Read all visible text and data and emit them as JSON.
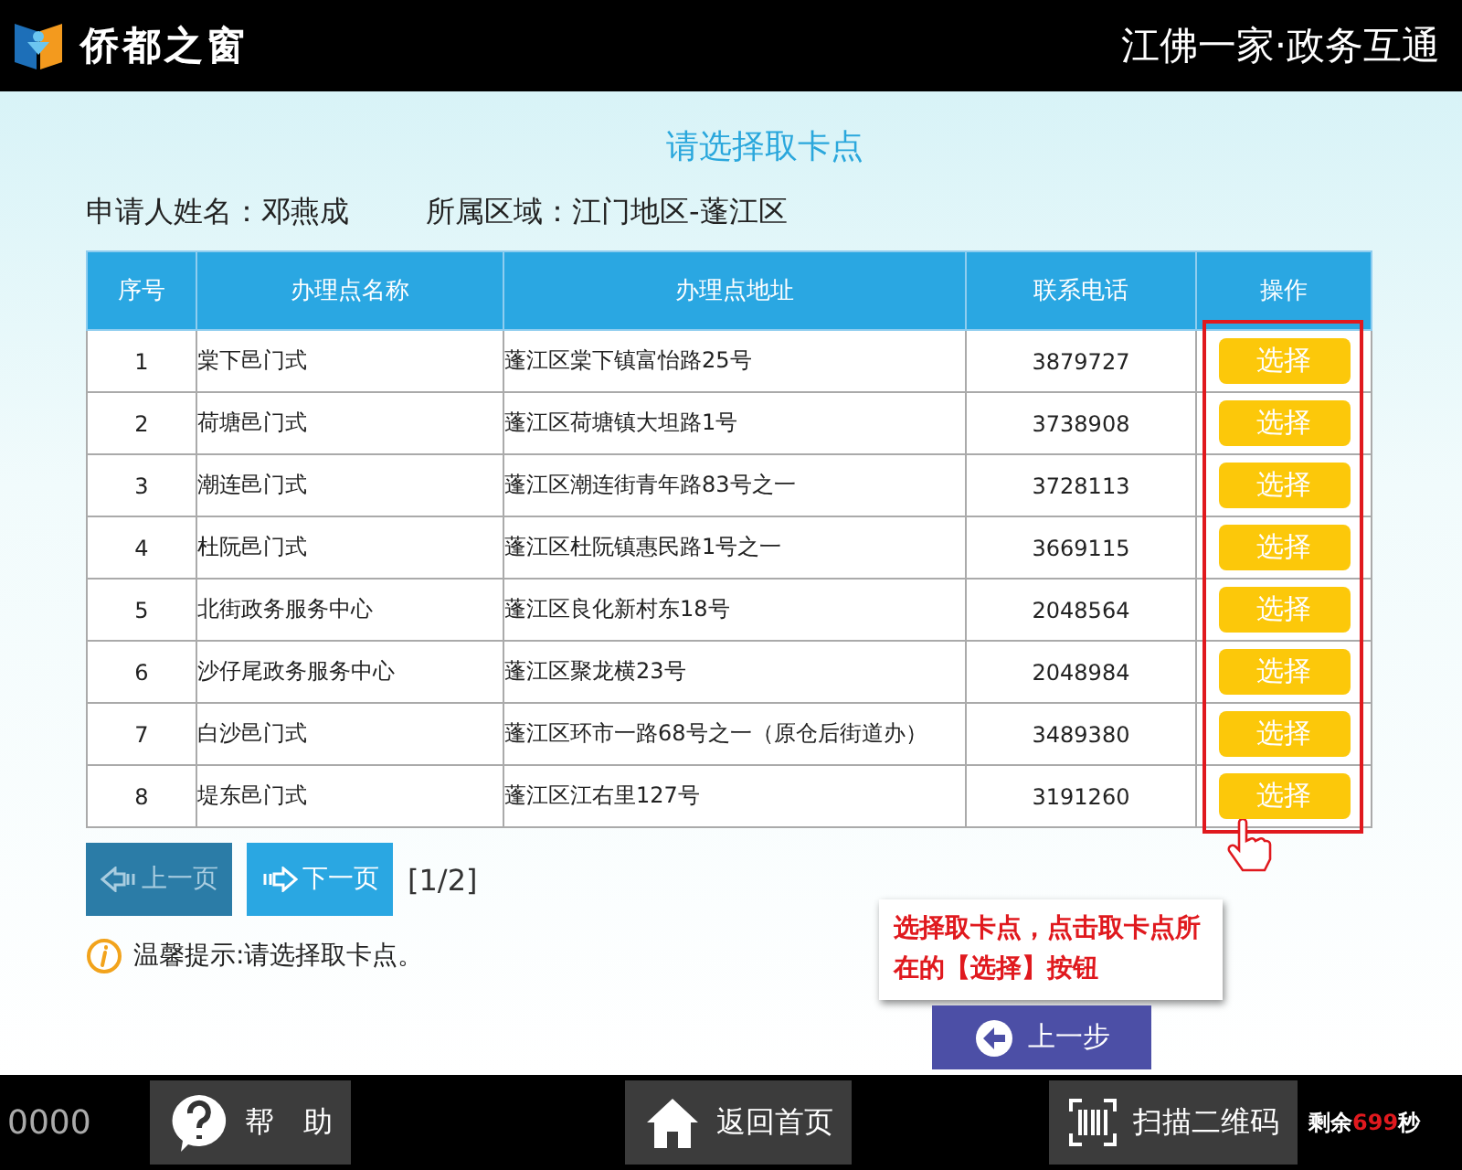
{
  "header": {
    "logo_text": "侨都之窗",
    "slogan": "江佛一家·政务互通"
  },
  "page_title": "请选择取卡点",
  "applicant": {
    "name_label": "申请人姓名：",
    "name": "邓燕成",
    "region_label": "所属区域：",
    "region": "江门地区-蓬江区"
  },
  "table": {
    "columns": [
      "序号",
      "办理点名称",
      "办理点地址",
      "联系电话",
      "操作"
    ],
    "rows": [
      {
        "index": "1",
        "name": "棠下邑门式",
        "address": "蓬江区棠下镇富怡路25号",
        "phone": "3879727",
        "action": "选择"
      },
      {
        "index": "2",
        "name": "荷塘邑门式",
        "address": "蓬江区荷塘镇大坦路1号",
        "phone": "3738908",
        "action": "选择"
      },
      {
        "index": "3",
        "name": "潮连邑门式",
        "address": "蓬江区潮连街青年路83号之一",
        "phone": "3728113",
        "action": "选择"
      },
      {
        "index": "4",
        "name": "杜阮邑门式",
        "address": "蓬江区杜阮镇惠民路1号之一",
        "phone": "3669115",
        "action": "选择"
      },
      {
        "index": "5",
        "name": "北街政务服务中心",
        "address": "蓬江区良化新村东18号",
        "phone": "2048564",
        "action": "选择"
      },
      {
        "index": "6",
        "name": "沙仔尾政务服务中心",
        "address": "蓬江区聚龙横23号",
        "phone": "2048984",
        "action": "选择"
      },
      {
        "index": "7",
        "name": "白沙邑门式",
        "address": "蓬江区环市一路68号之一（原仓后街道办）",
        "phone": "3489380",
        "action": "选择"
      },
      {
        "index": "8",
        "name": "堤东邑门式",
        "address": "蓬江区江右里127号",
        "phone": "3191260",
        "action": "选择"
      }
    ]
  },
  "pagination": {
    "prev": {
      "label": "上一页",
      "disabled": true
    },
    "next": {
      "label": "下一页",
      "disabled": false
    },
    "page": "[1/2]"
  },
  "tip": {
    "label": "温馨提示",
    "text": ":请选择取卡点。"
  },
  "callout": "选择取卡点，点击取卡点所在的【选择】按钮",
  "back_button": "上一步",
  "footer": {
    "code": "0000",
    "help": "帮　助",
    "home": "返回首页",
    "scan": "扫描二维码",
    "countdown": {
      "prefix": "剩余",
      "value": "699",
      "suffix": "秒"
    }
  }
}
